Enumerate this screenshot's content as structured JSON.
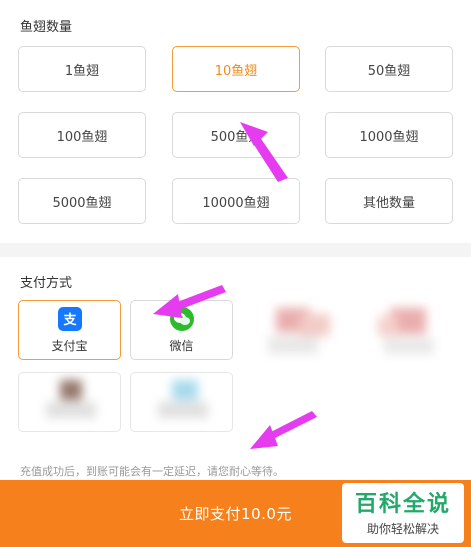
{
  "amount_section": {
    "title": "鱼翅数量",
    "options": [
      {
        "label": "1鱼翅"
      },
      {
        "label": "10鱼翅"
      },
      {
        "label": "50鱼翅"
      },
      {
        "label": "100鱼翅"
      },
      {
        "label": "500鱼翅"
      },
      {
        "label": "1000鱼翅"
      },
      {
        "label": "5000鱼翅"
      },
      {
        "label": "10000鱼翅"
      },
      {
        "label": "其他数量"
      }
    ],
    "selected_index": 1
  },
  "payment_section": {
    "title": "支付方式",
    "methods": [
      {
        "label": "支付宝",
        "icon": "alipay-icon"
      },
      {
        "label": "微信",
        "icon": "wechat-icon"
      }
    ],
    "selected_index": 0
  },
  "notice": "充值成功后，到账可能会有一定延迟，请您耐心等待。",
  "bottom_bar": {
    "pay_label": "立即支付10.0元"
  },
  "watermark": {
    "line1": "百科全说",
    "line2": "助你轻松解决"
  },
  "colors": {
    "accent": "#f39c3a",
    "pay_bar": "#f6811c",
    "alipay": "#1677ff",
    "wechat": "#2dbb2d",
    "arrow": "#e63cf0",
    "watermark_green": "#23a86b"
  }
}
